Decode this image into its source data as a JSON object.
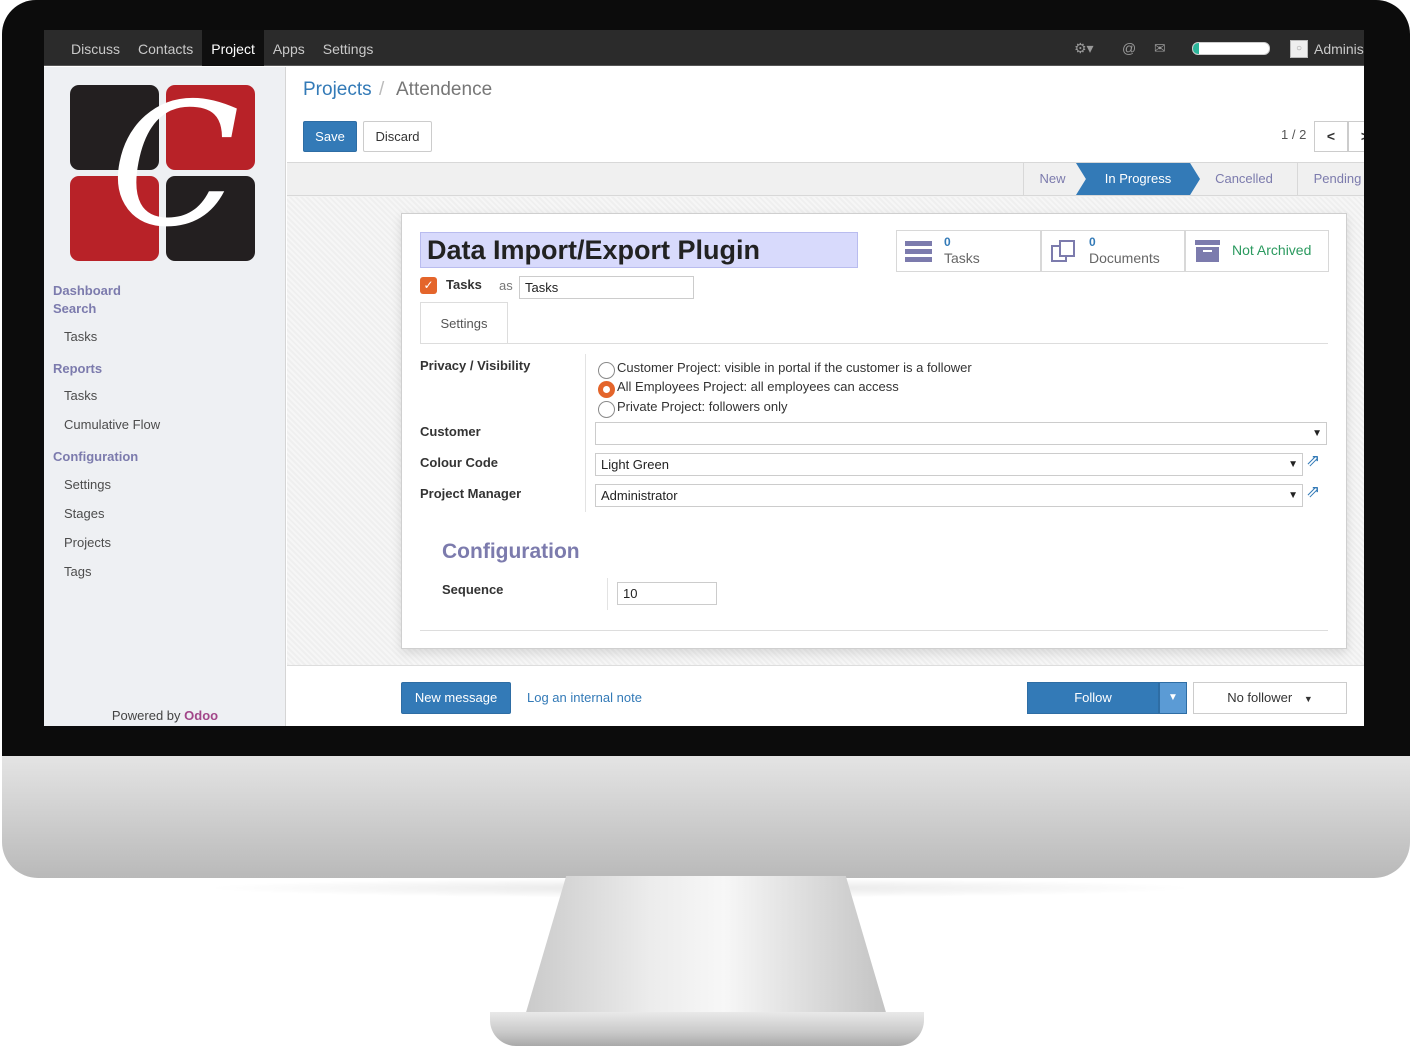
{
  "navbar": {
    "menu": [
      "Discuss",
      "Contacts",
      "Project",
      "Apps",
      "Settings"
    ],
    "active": "Project",
    "username": "Adminis",
    "progress_fraction": 0.08
  },
  "sidebar": {
    "sections": [
      {
        "label": "Dashboard"
      },
      {
        "label": "Search",
        "items": [
          "Tasks"
        ]
      },
      {
        "label": "Reports",
        "items": [
          "Tasks",
          "Cumulative Flow"
        ]
      },
      {
        "label": "Configuration",
        "items": [
          "Settings",
          "Stages",
          "Projects",
          "Tags"
        ]
      }
    ],
    "powered_by": "Powered by",
    "powered_brand": "Odoo"
  },
  "breadcrumb": {
    "parent": "Projects",
    "separator": "/",
    "current": "Attendence"
  },
  "buttons": {
    "save": "Save",
    "discard": "Discard"
  },
  "pager": {
    "value": "1 / 2",
    "prev": "<",
    "next": ">"
  },
  "stages": [
    "New",
    "In Progress",
    "Cancelled",
    "Pending"
  ],
  "active_stage": "In Progress",
  "record": {
    "title": "Data Import/Export Plugin",
    "use_tasks_label": "Tasks",
    "as": "as",
    "alias_value": "Tasks",
    "tab": "Settings"
  },
  "stat_buttons": [
    {
      "count": "0",
      "label": "Tasks",
      "icon": "tasks-icon"
    },
    {
      "count": "0",
      "label": "Documents",
      "icon": "documents-icon"
    },
    {
      "label": "Not Archived",
      "icon": "archive-icon"
    }
  ],
  "fields": {
    "privacy_label": "Privacy / Visibility",
    "privacy_options": [
      "Customer Project: visible in portal if the customer is a follower",
      "All Employees Project: all employees can access",
      "Private Project: followers only"
    ],
    "privacy_selected": 1,
    "customer_label": "Customer",
    "customer_value": "",
    "colour_label": "Colour Code",
    "colour_value": "Light Green",
    "manager_label": "Project Manager",
    "manager_value": "Administrator"
  },
  "configuration": {
    "heading": "Configuration",
    "sequence_label": "Sequence",
    "sequence_value": "10"
  },
  "chatter": {
    "new_message": "New message",
    "log_note": "Log an internal note",
    "follow": "Follow",
    "no_follower": "No follower"
  },
  "colors": {
    "accent": "#337ab7",
    "brand_purple": "#7c7bad",
    "checkbox_orange": "#e4652b",
    "navbar": "#2b2b2b"
  }
}
